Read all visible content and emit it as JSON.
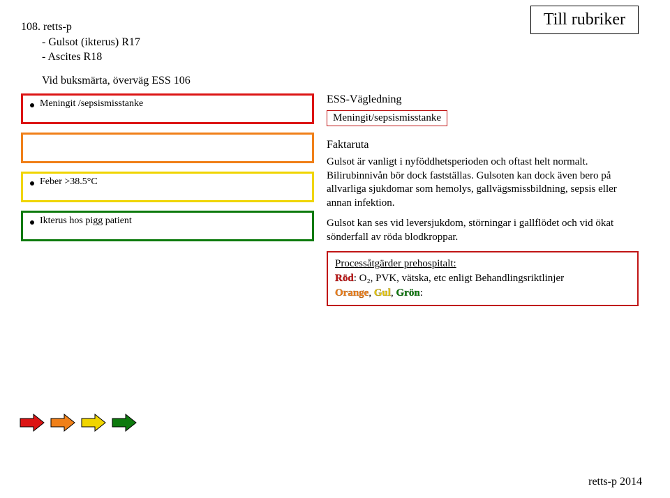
{
  "top_right": "Till rubriker",
  "header": {
    "code": "108. retts-p",
    "line1": "- Gulsot (ikterus) R17",
    "line2": "- Ascites R18",
    "sub": "Vid buksmärta, överväg ESS 106"
  },
  "ess": {
    "heading": "ESS-Vägledning",
    "link": "Meningit/sepsismisstanke"
  },
  "triage": {
    "red": "Meningit /sepsismisstanke",
    "orange": "",
    "yellow": "Feber >38.5°C",
    "green": "Ikterus hos pigg patient"
  },
  "faktaruta": {
    "title": "Faktaruta",
    "p1": "Gulsot är vanligt i nyföddhetsperioden och oftast helt normalt. Bilirubinnivån bör dock fastställas. Gulsoten kan dock även bero på allvarliga sjukdomar som hemolys, gallvägsmissbildning, sepsis eller annan infektion.",
    "p2": "Gulsot kan ses vid leversjukdom, störningar i gallflödet och vid ökat sönderfall av röda blodkroppar."
  },
  "process": {
    "heading": "Processåtgärder prehospitalt:",
    "red_label": "Röd",
    "red_text": ": O₂, PVK, vätska, etc enligt Behandlingsriktlinjer",
    "orange_label": "Orange",
    "yellow_label": "Gul",
    "green_label": "Grön",
    "rest_sep": ", ",
    "rest_colon": ":"
  },
  "footer": "retts-p 2014"
}
